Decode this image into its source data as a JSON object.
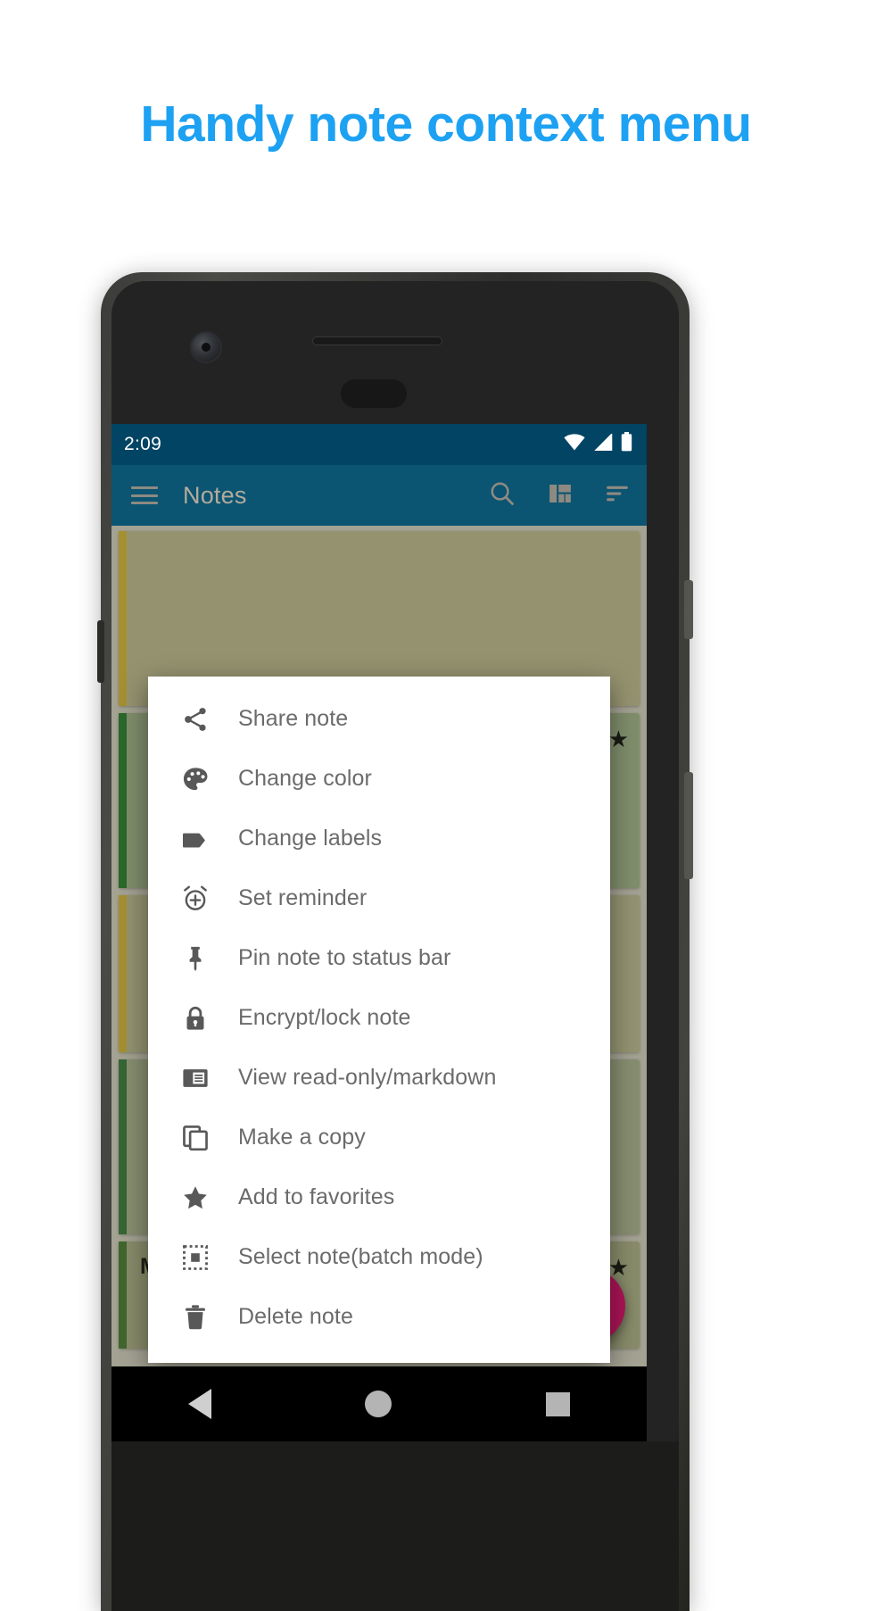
{
  "headline": "Handy note context menu",
  "colors": {
    "headline": "#1DA1F2",
    "status_bar": "#014463",
    "app_bar": "#0b5472",
    "fab": "#ad1457",
    "menu_text": "#6b6b6b",
    "menu_icon": "#585858"
  },
  "status_bar": {
    "time": "2:09",
    "icons": [
      "wifi-icon",
      "cell-signal-icon",
      "battery-icon"
    ]
  },
  "app_bar": {
    "menu_icon": "hamburger-menu-icon",
    "title": "Notes",
    "actions": [
      {
        "name": "search-icon",
        "label": "Search"
      },
      {
        "name": "layout-grid-icon",
        "label": "Layout"
      },
      {
        "name": "sort-icon",
        "label": "Sort"
      }
    ]
  },
  "context_menu": {
    "items": [
      {
        "icon": "share-icon",
        "label": "Share note"
      },
      {
        "icon": "palette-icon",
        "label": "Change color"
      },
      {
        "icon": "label-tag-icon",
        "label": "Change labels"
      },
      {
        "icon": "alarm-add-icon",
        "label": "Set reminder"
      },
      {
        "icon": "pin-icon",
        "label": "Pin note to status bar"
      },
      {
        "icon": "lock-icon",
        "label": "Encrypt/lock note"
      },
      {
        "icon": "read-only-icon",
        "label": "View read-only/markdown"
      },
      {
        "icon": "copy-icon",
        "label": "Make a copy"
      },
      {
        "icon": "star-icon",
        "label": "Add to favorites"
      },
      {
        "icon": "select-batch-icon",
        "label": "Select note(batch mode)"
      },
      {
        "icon": "trash-icon",
        "label": "Delete note"
      }
    ]
  },
  "notes": [
    {
      "title": "",
      "body": "",
      "accent": "#c9b03a",
      "bg": "#b7b489",
      "starred": false
    },
    {
      "title": "",
      "body": "",
      "accent": "#2f7d32",
      "bg": "#9cae86",
      "starred": true
    },
    {
      "title": "",
      "body": "",
      "accent": "#c9b03a",
      "bg": "#b4b48c",
      "starred": false
    },
    {
      "title": "",
      "body": "",
      "accent": "#3d7a3d",
      "bg": "#a5ad8b",
      "starred": false
    },
    {
      "title": "My supersecret journal",
      "body": "",
      "accent": "#4a7a36",
      "bg": "#a6ab83",
      "starred": true
    }
  ],
  "fab": {
    "label": "+",
    "name": "add-note-fab"
  },
  "nav_bar": {
    "items": [
      {
        "name": "nav-back-button",
        "label": "Back"
      },
      {
        "name": "nav-home-button",
        "label": "Home"
      },
      {
        "name": "nav-recents-button",
        "label": "Recents"
      }
    ]
  }
}
